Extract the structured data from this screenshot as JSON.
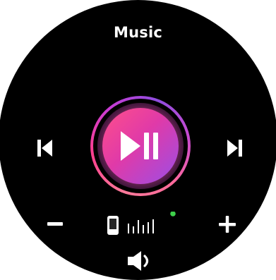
{
  "screen": {
    "title": "Music"
  },
  "controls": {
    "previous_icon": "skip-previous-icon",
    "next_icon": "skip-next-icon",
    "play_pause_icon": "play-pause-icon",
    "volume_down_icon": "minus-icon",
    "volume_up_icon": "plus-icon",
    "output_device_icon": "phone-icon",
    "volume_level_icon": "volume-level-bars-icon",
    "speaker_icon": "speaker-icon"
  },
  "status": {
    "connected_indicator": "green-dot",
    "connected_color": "#3ecf4a"
  },
  "colors": {
    "background": "#000000",
    "accent_start": "#ff4f8a",
    "accent_end": "#9b4ee6",
    "icon": "#ffffff"
  }
}
